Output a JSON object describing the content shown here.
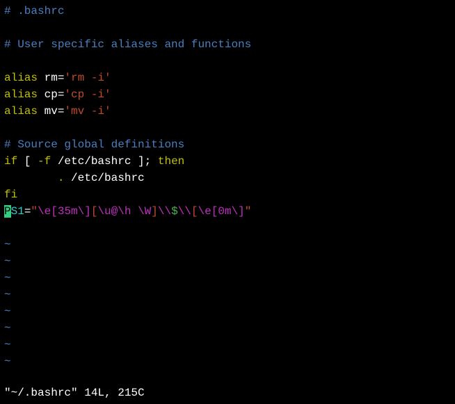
{
  "comments": {
    "title": "# .bashrc",
    "user_specific": "# User specific aliases and functions",
    "source_global": "# Source global definitions"
  },
  "aliases": {
    "rm": {
      "kw": "alias",
      "name": " rm=",
      "val": "'rm -i'"
    },
    "cp": {
      "kw": "alias",
      "name": " cp=",
      "val": "'cp -i'"
    },
    "mv": {
      "kw": "alias",
      "name": " mv=",
      "val": "'mv -i'"
    }
  },
  "ifblock": {
    "if_kw": "if",
    "cond_open": " [ ",
    "flag": "-f",
    "path1": " /etc/bashrc ",
    "cond_close": "]; ",
    "then_kw": "then",
    "indent": "        ",
    "dot": ".",
    "path2": " /etc/bashrc",
    "fi_kw": "fi"
  },
  "ps1": {
    "cursor_char": "P",
    "var": "S1",
    "eq": "=",
    "q1": "\"",
    "esc1": "\\e[35m\\]",
    "body_open": "[",
    "user_host": "\\u@\\h \\W",
    "body_close": "]",
    "dollar": "\\\\",
    "dollar2": "$",
    "dollar3": "\\\\",
    "esc2_open": "[",
    "esc2": "\\e[0m\\]",
    "q2": "\""
  },
  "tilde": "~",
  "status": "\"~/.bashrc\" 14L, 215C"
}
